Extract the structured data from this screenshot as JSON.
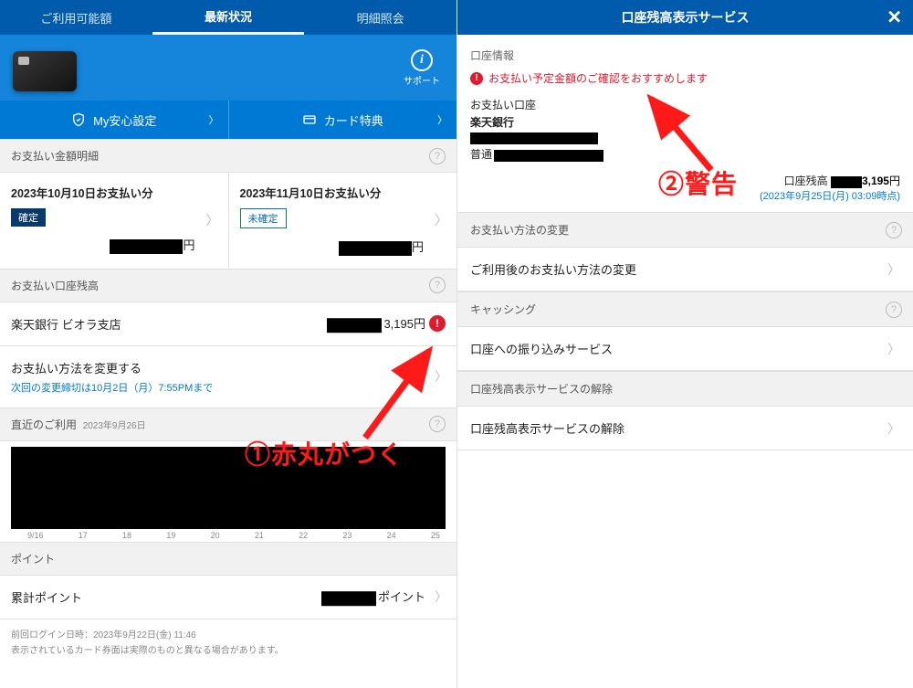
{
  "left": {
    "tabs": {
      "credit": "ご利用可能額",
      "latest": "最新状況",
      "details": "明細照会"
    },
    "support": "サポート",
    "btn_safe": "My安心設定",
    "btn_benefit": "カード特典",
    "sec_payment": "お支払い金額明細",
    "pay": [
      {
        "date": "2023年10月10日お支払い分",
        "status": "確定",
        "status_kind": "confirmed",
        "unit": "円"
      },
      {
        "date": "2023年11月10日お支払い分",
        "status": "未確定",
        "status_kind": "pending",
        "unit": "円"
      }
    ],
    "sec_balance": "お支払い口座残高",
    "bank_row": {
      "bank": "楽天銀行 ビオラ支店",
      "amount": "3,195",
      "unit": "円"
    },
    "sec_change": "お支払い方法を変更する",
    "change_sub": "次回の変更締切は10月2日（月）7:55PMまで",
    "sec_recent": "直近のご利用",
    "recent_date": "2023年9月26日",
    "xaxis": [
      "9/16",
      "17",
      "18",
      "19",
      "20",
      "21",
      "22",
      "23",
      "24",
      "25"
    ],
    "sec_point": "ポイント",
    "point_row": {
      "label": "累計ポイント",
      "unit": "ポイント"
    },
    "prev_login": "前回ログイン日時：2023年9月22日(金) 11:46",
    "disclaimer": "表示されているカード券面は実際のものと異なる場合があります。"
  },
  "right": {
    "title": "口座残高表示サービス",
    "sec_info": "口座情報",
    "alert": "お支払い予定金額のご確認をおすすめします",
    "acct_label": "お支払い口座",
    "bank": "楽天銀行",
    "acct_type": "普通",
    "bal_label": "口座残高",
    "bal_amount": "3,195",
    "bal_unit": "円",
    "timestamp": "(2023年9月25日(月) 03:09時点)",
    "grp_change": "お支払い方法の変更",
    "row_change": "ご利用後のお支払い方法の変更",
    "grp_cash": "キャッシング",
    "row_cash": "口座への振り込みサービス",
    "grp_cancel": "口座残高表示サービスの解除",
    "row_cancel": "口座残高表示サービスの解除"
  },
  "annotations": {
    "a1": "①赤丸がつく",
    "a2": "②警告"
  }
}
